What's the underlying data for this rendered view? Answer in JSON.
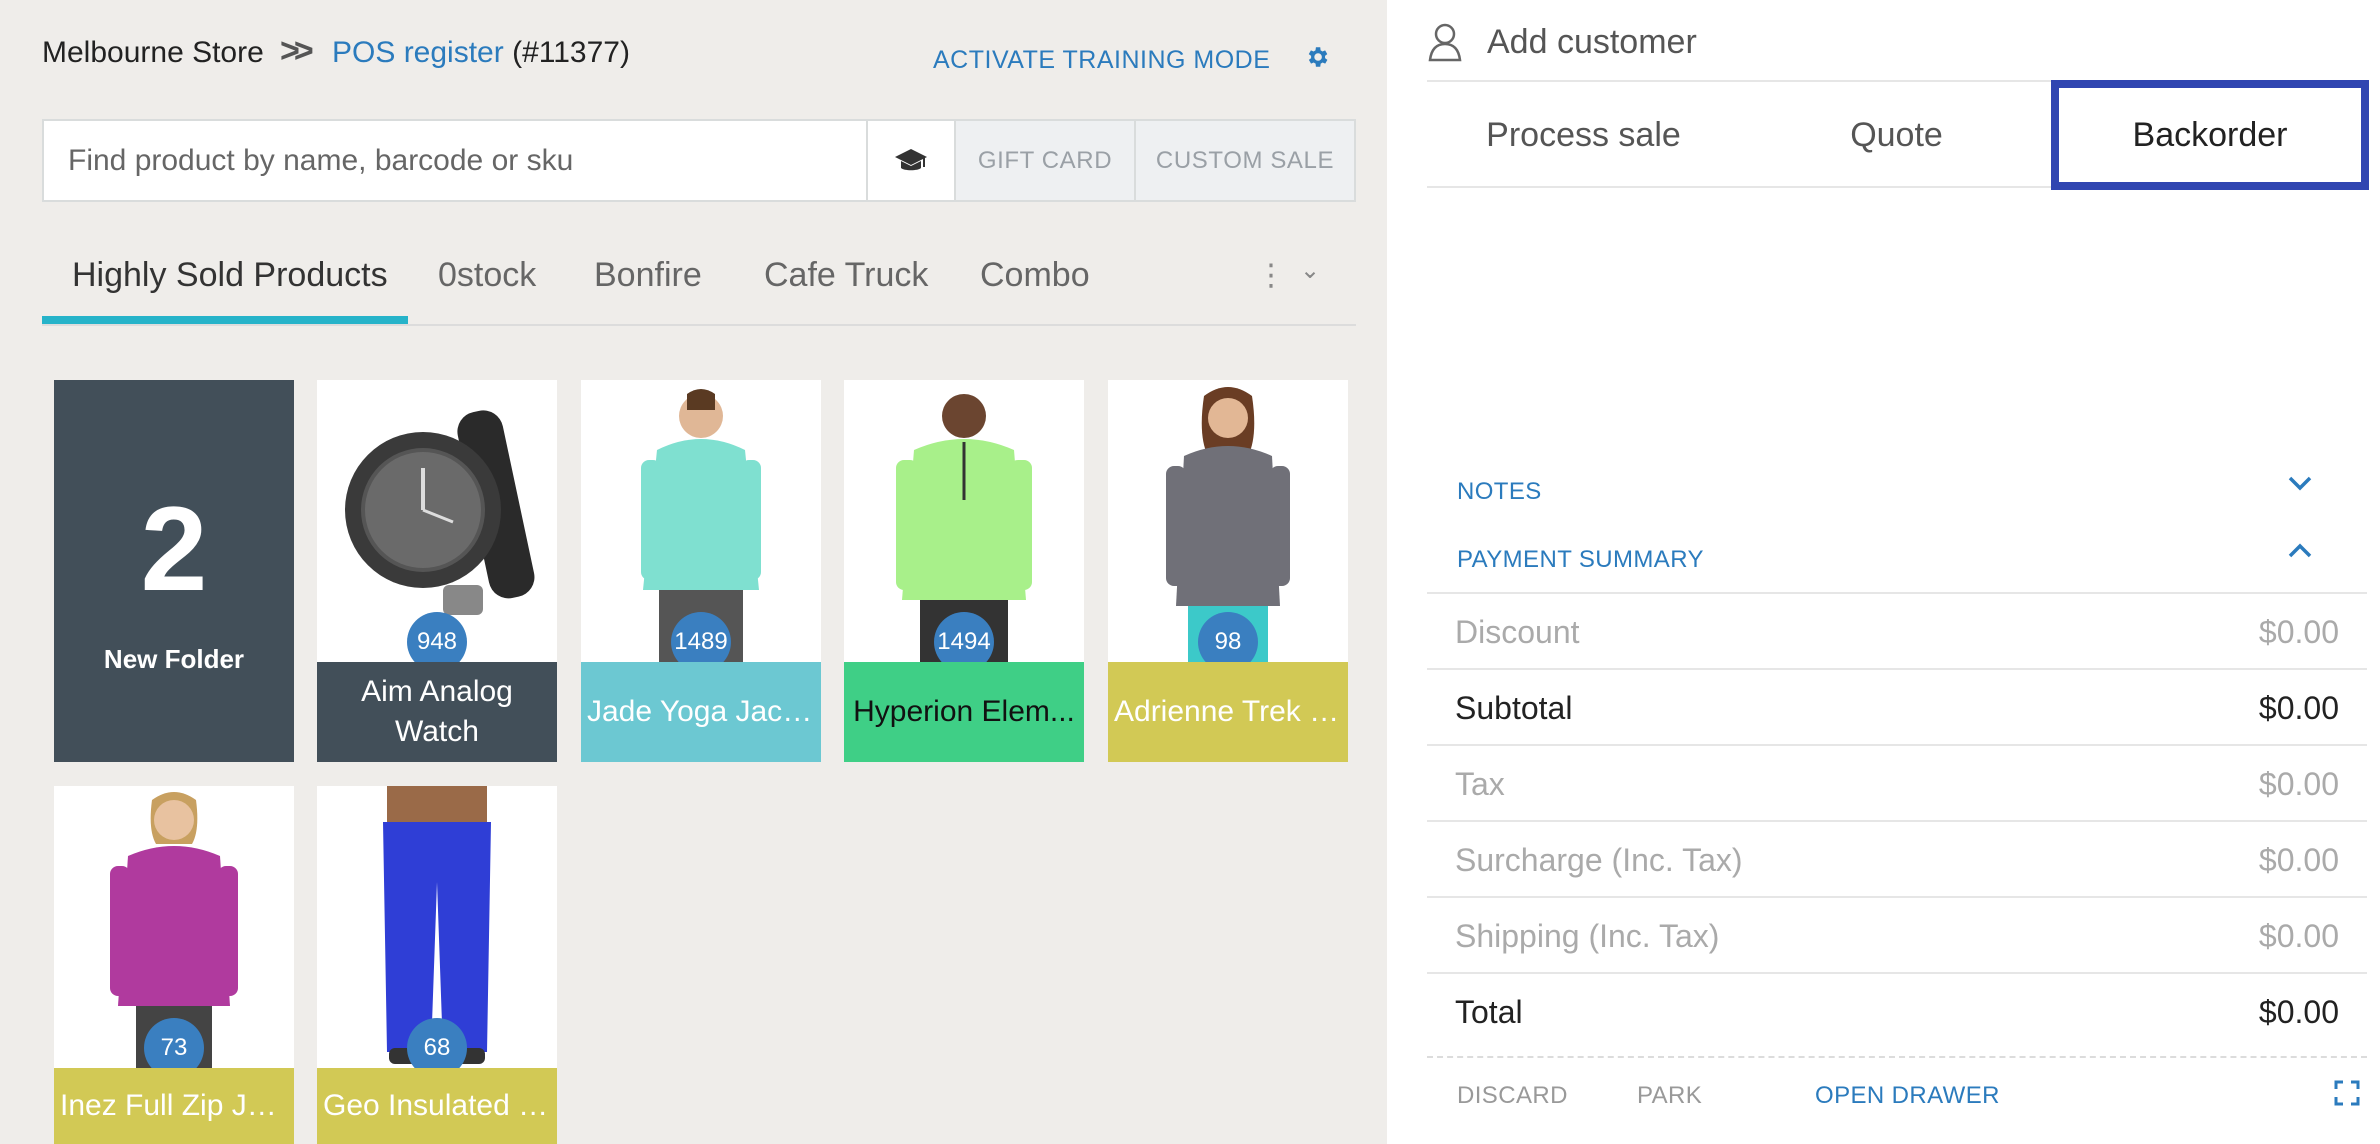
{
  "header": {
    "store": "Melbourne Store",
    "separator": ">>",
    "register_link": "POS register",
    "register_id": "(#11377)",
    "training_button": "ACTIVATE TRAINING MODE",
    "settings_icon": "gear-icon"
  },
  "search": {
    "placeholder": "Find product by name, barcode or sku",
    "value": "",
    "cap_icon": "graduation-cap-icon",
    "gift_card": "GIFT CARD",
    "custom_sale": "CUSTOM SALE"
  },
  "tabs": [
    {
      "label": "Highly Sold Products",
      "active": true
    },
    {
      "label": "0stock"
    },
    {
      "label": "Bonfire"
    },
    {
      "label": "Cafe Truck"
    },
    {
      "label": "Combo"
    }
  ],
  "folder": {
    "count": "2",
    "name": "New Folder"
  },
  "products": [
    {
      "name": "Aim Analog Watch",
      "badge": "948",
      "color": "#424f59"
    },
    {
      "name": "Jade Yoga Jacket",
      "badge": "1489",
      "color": "#6cc8d2"
    },
    {
      "name": "Hyperion Elem...",
      "badge": "1494",
      "color": "#3fcf86"
    },
    {
      "name": "Adrienne Trek J...",
      "badge": "98",
      "color": "#d2c955"
    },
    {
      "name": "Inez Full Zip Ja...",
      "badge": "73",
      "color": "#d2c955"
    },
    {
      "name": "Geo Insulated J...",
      "badge": "68",
      "color": "#d2c955"
    }
  ],
  "right": {
    "customer_label": "Add customer",
    "modes": [
      "Process sale",
      "Quote",
      "Backorder"
    ],
    "selected_mode": "Backorder",
    "notes": "NOTES",
    "payment_summary": "PAYMENT SUMMARY",
    "summary": [
      {
        "label": "Discount",
        "value": "$0.00"
      },
      {
        "label": "Subtotal",
        "value": "$0.00"
      },
      {
        "label": "Tax",
        "value": "$0.00"
      },
      {
        "label": "Surcharge (Inc. Tax)",
        "value": "$0.00"
      },
      {
        "label": "Shipping (Inc. Tax)",
        "value": "$0.00"
      },
      {
        "label": "Total",
        "value": "$0.00"
      }
    ],
    "footer": {
      "discard": "DISCARD",
      "park": "PARK",
      "open_drawer": "OPEN DRAWER"
    }
  },
  "colors": {
    "accent": "#2b7bbd",
    "tab_underline": "#26b3c9",
    "selected_border": "#3045b1"
  }
}
